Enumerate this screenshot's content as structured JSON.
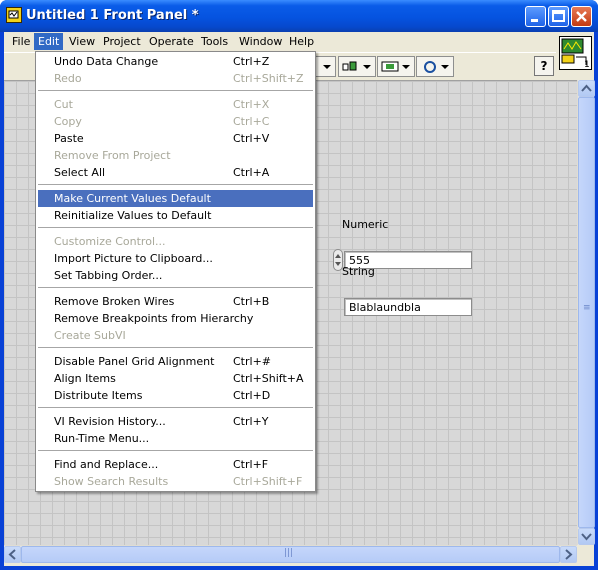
{
  "window": {
    "title": "Untitled 1 Front Panel *",
    "controls": {
      "minimize": "minimize",
      "maximize": "maximize",
      "close": "close"
    }
  },
  "menubar": {
    "items": [
      {
        "label": "File"
      },
      {
        "label": "Edit"
      },
      {
        "label": "View"
      },
      {
        "label": "Project"
      },
      {
        "label": "Operate"
      },
      {
        "label": "Tools"
      },
      {
        "label": "Window"
      },
      {
        "label": "Help"
      }
    ],
    "active": "Edit"
  },
  "toolbar": {
    "icons": [
      "align-objects-icon",
      "distribute-objects-icon",
      "resize-objects-icon",
      "reorder-icon"
    ],
    "help_label": "?"
  },
  "vi_icon": {
    "number": "1"
  },
  "front_panel": {
    "numeric": {
      "label": "Numeric",
      "value": "555"
    },
    "string": {
      "label": "String",
      "value": "Blablaundbla"
    }
  },
  "edit_menu": {
    "groups": [
      [
        {
          "label": "Undo Data Change",
          "shortcut": "Ctrl+Z",
          "enabled": true
        },
        {
          "label": "Redo",
          "shortcut": "Ctrl+Shift+Z",
          "enabled": false
        }
      ],
      [
        {
          "label": "Cut",
          "shortcut": "Ctrl+X",
          "enabled": false
        },
        {
          "label": "Copy",
          "shortcut": "Ctrl+C",
          "enabled": false
        },
        {
          "label": "Paste",
          "shortcut": "Ctrl+V",
          "enabled": true
        },
        {
          "label": "Remove From Project",
          "shortcut": "",
          "enabled": false
        },
        {
          "label": "Select All",
          "shortcut": "Ctrl+A",
          "enabled": true
        }
      ],
      [
        {
          "label": "Make Current Values Default",
          "shortcut": "",
          "enabled": true,
          "selected": true
        },
        {
          "label": "Reinitialize Values to Default",
          "shortcut": "",
          "enabled": true
        }
      ],
      [
        {
          "label": "Customize Control...",
          "shortcut": "",
          "enabled": false
        },
        {
          "label": "Import Picture to Clipboard...",
          "shortcut": "",
          "enabled": true
        },
        {
          "label": "Set Tabbing Order...",
          "shortcut": "",
          "enabled": true
        }
      ],
      [
        {
          "label": "Remove Broken Wires",
          "shortcut": "Ctrl+B",
          "enabled": true
        },
        {
          "label": "Remove Breakpoints from Hierarchy",
          "shortcut": "",
          "enabled": true
        },
        {
          "label": "Create SubVI",
          "shortcut": "",
          "enabled": false
        }
      ],
      [
        {
          "label": "Disable Panel Grid Alignment",
          "shortcut": "Ctrl+#",
          "enabled": true
        },
        {
          "label": "Align Items",
          "shortcut": "Ctrl+Shift+A",
          "enabled": true
        },
        {
          "label": "Distribute Items",
          "shortcut": "Ctrl+D",
          "enabled": true
        }
      ],
      [
        {
          "label": "VI Revision History...",
          "shortcut": "Ctrl+Y",
          "enabled": true
        },
        {
          "label": "Run-Time Menu...",
          "shortcut": "",
          "enabled": true
        }
      ],
      [
        {
          "label": "Find and Replace...",
          "shortcut": "Ctrl+F",
          "enabled": true
        },
        {
          "label": "Show Search Results",
          "shortcut": "Ctrl+Shift+F",
          "enabled": false
        }
      ]
    ]
  },
  "colors": {
    "titlebar": "#0553e0",
    "menu_highlight": "#316ac5",
    "selected_item": "#4a6fbe",
    "disabled_text": "#a8a89a",
    "panel_grid": "#d8d8d8"
  }
}
